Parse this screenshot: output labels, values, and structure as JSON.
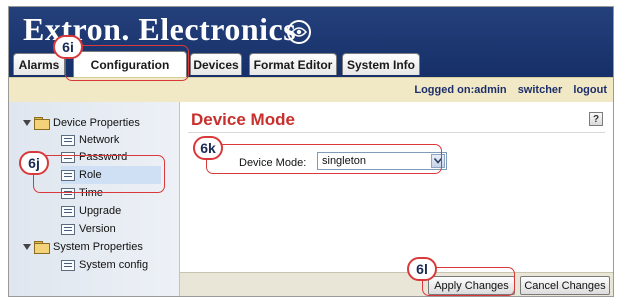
{
  "header": {
    "logo_text": "Extron. Electronics"
  },
  "tabs": [
    {
      "label": "Alarms"
    },
    {
      "label": "Configuration"
    },
    {
      "label": "Devices"
    },
    {
      "label": "Format Editor"
    },
    {
      "label": "System Info"
    }
  ],
  "status": {
    "logged_on": "Logged on:admin",
    "user": "switcher",
    "logout": "logout"
  },
  "sidebar": {
    "groups": [
      {
        "label": "Device Properties",
        "items": [
          {
            "label": "Network"
          },
          {
            "label": "Password"
          },
          {
            "label": "Role"
          },
          {
            "label": "Time"
          },
          {
            "label": "Upgrade"
          },
          {
            "label": "Version"
          }
        ]
      },
      {
        "label": "System Properties",
        "items": [
          {
            "label": "System config"
          }
        ]
      }
    ]
  },
  "main": {
    "title": "Device Mode",
    "help_label": "?",
    "device_mode_label": "Device Mode:",
    "device_mode_value": "singleton"
  },
  "buttons": {
    "apply": "Apply Changes",
    "cancel": "Cancel Changes"
  },
  "callouts": [
    {
      "label": "6i"
    },
    {
      "label": "6j"
    },
    {
      "label": "6k"
    },
    {
      "label": "6l"
    }
  ],
  "colors": {
    "header_bg": "#1b3570",
    "title_red": "#c8302d",
    "callout_red": "#d9393a",
    "status_bar": "#f1e9c6"
  }
}
